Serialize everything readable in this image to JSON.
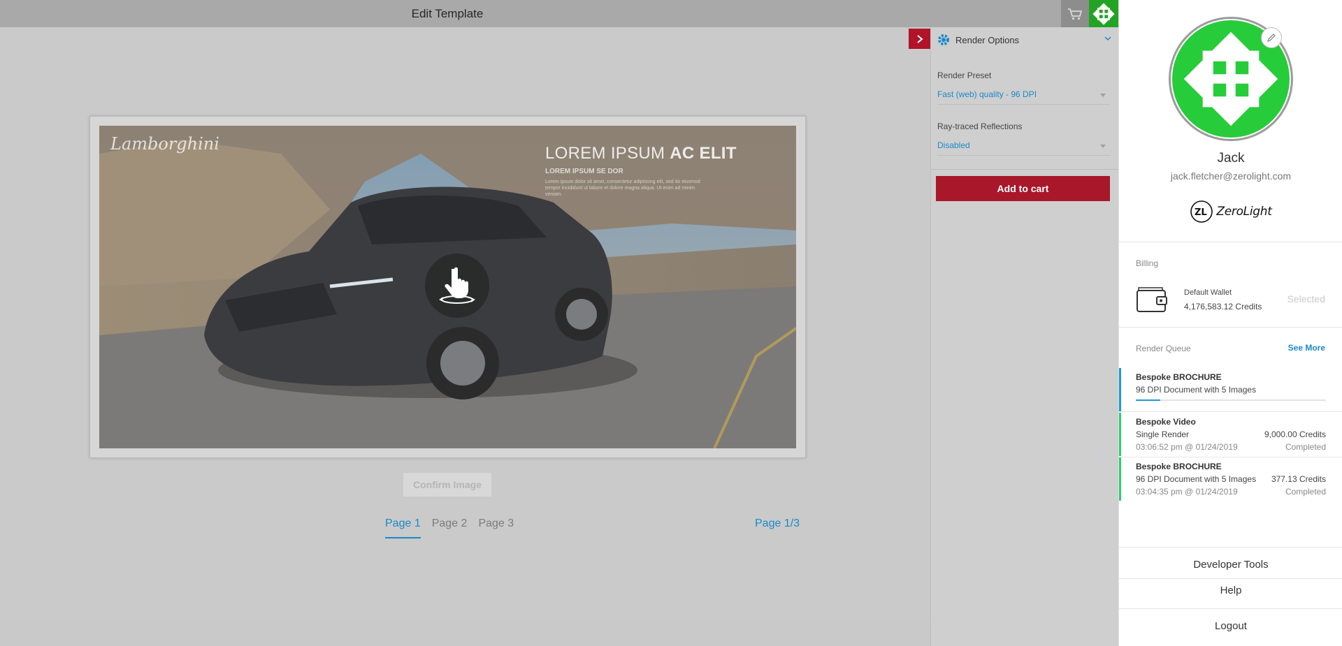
{
  "header": {
    "title": "Edit Template"
  },
  "icons": {
    "cart": "cart-icon",
    "avatar": "zerolight-avatar-icon",
    "collapse": "chevron-right-icon",
    "gear": "gear-icon",
    "edit": "pencil-icon",
    "wallet": "wallet-icon",
    "rotate": "hand-rotate-icon"
  },
  "colors": {
    "accent": "#1b88c8",
    "brand_red": "#a8172a",
    "avatar_green": "#23a324",
    "queue_active": "#1b9ad6",
    "queue_done": "#2ecc71"
  },
  "template": {
    "brand": "Lamborghini",
    "headline_light": "LOREM IPSUM ",
    "headline_bold": "AC ELIT",
    "subheadline": "LOREM IPSUM SE DOR",
    "body": "Lorem ipsum dolor sit amet, consectetur adipiscing elit, sed do eiusmod tempor incididunt ut labore et dolore magna aliqua. Ut enim ad minim veniam."
  },
  "editor": {
    "confirm_label": "Confirm Image",
    "pages": [
      "Page 1",
      "Page 2",
      "Page 3"
    ],
    "active_page": 0,
    "page_counter": "Page 1/3"
  },
  "toolbar": {
    "tools": [
      "environment-icon",
      "paint-icon",
      "seat-icon",
      "camera-icon",
      "annotation-icon"
    ]
  },
  "render_options": {
    "title": "Render Options",
    "preset_label": "Render Preset",
    "preset_value": "Fast (web) quality - 96 DPI",
    "reflections_label": "Ray-traced Reflections",
    "reflections_value": "Disabled",
    "add_to_cart": "Add to cart"
  },
  "account": {
    "name": "Jack",
    "email": "jack.fletcher@zerolight.com",
    "logo_mark": "ZL",
    "logo_text": "ZeroLight",
    "billing_label": "Billing",
    "wallet_name": "Default Wallet",
    "wallet_credits": "4,176,583.12 Credits",
    "wallet_state": "Selected",
    "queue_label": "Render Queue",
    "see_more": "See More",
    "queue": [
      {
        "title": "Bespoke BROCHURE",
        "subtitle": "96 DPI Document with 5 Images",
        "progress": 0.13,
        "status_color": "#1b9ad6"
      },
      {
        "title": "Bespoke Video",
        "subtitle": "Single Render",
        "time": "03:06:52 pm @ 01/24/2019",
        "cost": "9,000.00 Credits",
        "status": "Completed",
        "status_color": "#2ecc71"
      },
      {
        "title": "Bespoke BROCHURE",
        "subtitle": "96 DPI Document with 5 Images",
        "time": "03:04:35 pm @ 01/24/2019",
        "cost": "377.13 Credits",
        "status": "Completed",
        "status_color": "#2ecc71"
      }
    ],
    "links": {
      "developer": "Developer Tools",
      "help": "Help",
      "logout": "Logout"
    }
  }
}
